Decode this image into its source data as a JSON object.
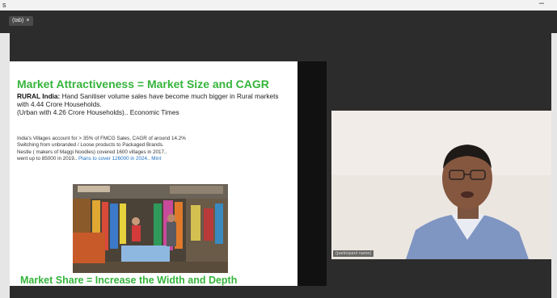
{
  "window": {
    "title_glyph": "s",
    "minimize": "–"
  },
  "share_tab": {
    "label": "(tab)",
    "close": "×"
  },
  "slide": {
    "title": "Market Attractiveness = Market Size and CAGR",
    "rural_heading": "RURAL India:",
    "rural_text": "Hand Sanitiser volume sales have become much bigger in Rural markets with 4.44 Crore Households.",
    "urban_text": "(Urban with 4.26 Crore Households).. Economic Times",
    "villages_line1": "India's Villages account for > 35% of FMCG Sales, CAGR of around 14.2%",
    "villages_line2": "Switching from unbranded / Loose products to Packaged Brands.",
    "villages_line3": "Nestle ( makers of Maggi Noodles) covered 1600 villages in 2017..",
    "villages_line4": "went up to 85000 in 2019..",
    "villages_link": "Plans to cover 126000 in 2024.. Mint",
    "bottom_title": "Market Share = Increase the Width and Depth"
  },
  "video": {
    "participant_name": "(participant name)"
  }
}
